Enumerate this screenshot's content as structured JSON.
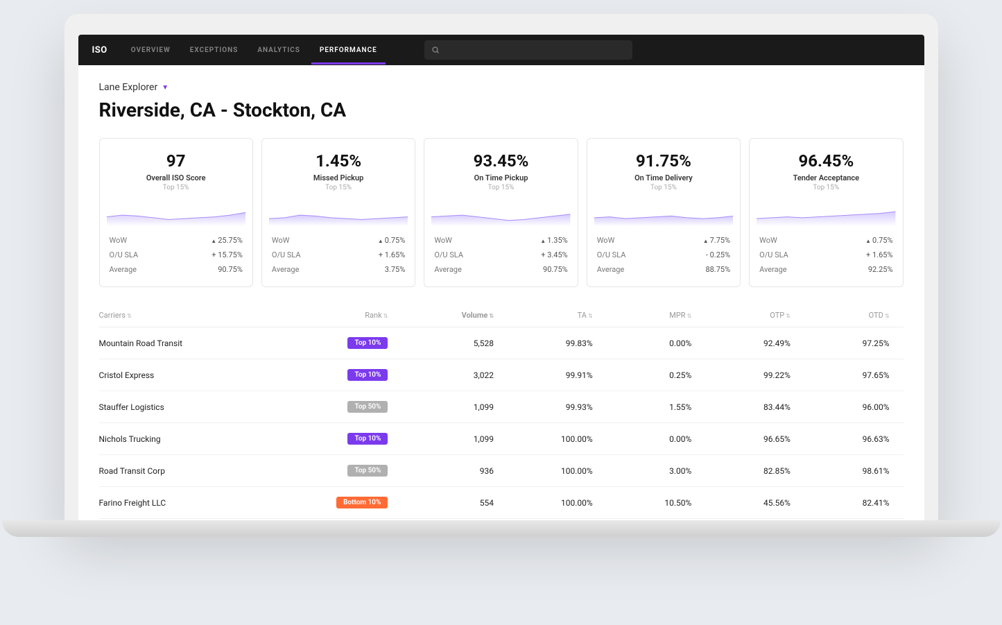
{
  "app_name": "ISO",
  "nav": [
    {
      "label": "OVERVIEW",
      "active": false
    },
    {
      "label": "EXCEPTIONS",
      "active": false
    },
    {
      "label": "ANALYTICS",
      "active": false
    },
    {
      "label": "PERFORMANCE",
      "active": true
    }
  ],
  "breadcrumb": "Lane Explorer",
  "page_title": "Riverside, CA - Stockton, CA",
  "cards": [
    {
      "value": "97",
      "label": "Overall ISO Score",
      "sub": "Top 15%",
      "wow": "25.75%",
      "ousla": "+ 15.75%",
      "avg": "90.75%"
    },
    {
      "value": "1.45%",
      "label": "Missed Pickup",
      "sub": "Top 15%",
      "wow": "0.75%",
      "ousla": "+ 1.65%",
      "avg": "3.75%"
    },
    {
      "value": "93.45%",
      "label": "On Time Pickup",
      "sub": "Top 15%",
      "wow": "1.35%",
      "ousla": "+ 3.45%",
      "avg": "90.75%"
    },
    {
      "value": "91.75%",
      "label": "On Time Delivery",
      "sub": "Top 15%",
      "wow": "7.75%",
      "ousla": "- 0.25%",
      "avg": "88.75%"
    },
    {
      "value": "96.45%",
      "label": "Tender Acceptance",
      "sub": "Top 15%",
      "wow": "0.75%",
      "ousla": "+ 1.65%",
      "avg": "92.25%"
    }
  ],
  "stat_labels": {
    "wow": "WoW",
    "ousla": "O/U SLA",
    "avg": "Average"
  },
  "table": {
    "headers": {
      "carriers": "Carriers",
      "rank": "Rank",
      "volume": "Volume",
      "ta": "TA",
      "mpr": "MPR",
      "otp": "OTP",
      "otd": "OTD"
    },
    "rows": [
      {
        "carrier": "Mountain Road Transit",
        "rank": "Top 10%",
        "rank_cls": "top10",
        "volume": "5,528",
        "ta": "99.83%",
        "mpr": "0.00%",
        "otp": "92.49%",
        "otd": "97.25%"
      },
      {
        "carrier": "Cristol Express",
        "rank": "Top 10%",
        "rank_cls": "top10",
        "volume": "3,022",
        "ta": "99.91%",
        "mpr": "0.25%",
        "otp": "99.22%",
        "otd": "97.65%"
      },
      {
        "carrier": "Stauffer Logistics",
        "rank": "Top 50%",
        "rank_cls": "top50",
        "volume": "1,099",
        "ta": "99.93%",
        "mpr": "1.55%",
        "otp": "83.44%",
        "otd": "96.00%"
      },
      {
        "carrier": "Nichols Trucking",
        "rank": "Top 10%",
        "rank_cls": "top10",
        "volume": "1,099",
        "ta": "100.00%",
        "mpr": "0.00%",
        "otp": "96.65%",
        "otd": "96.63%"
      },
      {
        "carrier": "Road Transit Corp",
        "rank": "Top 50%",
        "rank_cls": "top50",
        "volume": "936",
        "ta": "100.00%",
        "mpr": "3.00%",
        "otp": "82.85%",
        "otd": "98.61%"
      },
      {
        "carrier": "Farino Freight LLC",
        "rank": "Bottom 10%",
        "rank_cls": "bottom10",
        "volume": "554",
        "ta": "100.00%",
        "mpr": "10.50%",
        "otp": "45.56%",
        "otd": "82.41%"
      }
    ]
  },
  "chart_data": [
    {
      "type": "area",
      "title": "Overall ISO Score",
      "values": [
        78,
        82,
        80,
        76,
        72,
        74,
        76,
        78,
        82,
        88
      ],
      "ylim": [
        60,
        100
      ]
    },
    {
      "type": "area",
      "title": "Missed Pickup",
      "values": [
        74,
        76,
        82,
        80,
        76,
        74,
        72,
        74,
        76,
        78
      ],
      "ylim": [
        60,
        100
      ]
    },
    {
      "type": "area",
      "title": "On Time Pickup",
      "values": [
        78,
        80,
        82,
        78,
        74,
        70,
        72,
        76,
        80,
        84
      ],
      "ylim": [
        60,
        100
      ]
    },
    {
      "type": "area",
      "title": "On Time Delivery",
      "values": [
        76,
        78,
        74,
        76,
        78,
        80,
        76,
        74,
        76,
        80
      ],
      "ylim": [
        60,
        100
      ]
    },
    {
      "type": "area",
      "title": "Tender Acceptance",
      "values": [
        74,
        76,
        78,
        76,
        78,
        80,
        82,
        84,
        86,
        90
      ],
      "ylim": [
        60,
        100
      ]
    }
  ]
}
